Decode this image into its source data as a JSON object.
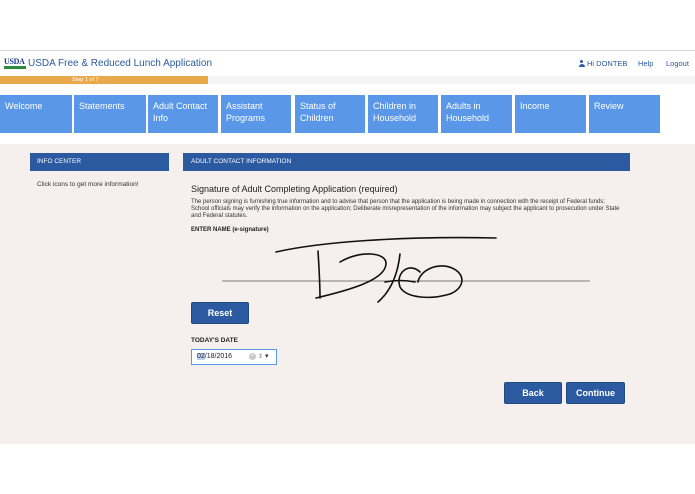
{
  "header": {
    "logo_text": "USDA",
    "app_title": "USDA Free & Reduced Lunch Application",
    "user_label": "Hi DONTEB",
    "help_label": "Help",
    "logout_label": "Logout"
  },
  "progress": {
    "label": "Step 1 of 7",
    "current_step": 1,
    "total_steps": 7
  },
  "nav": {
    "tabs": [
      {
        "label": "Welcome"
      },
      {
        "label": "Statements"
      },
      {
        "label": "Adult Contact Info"
      },
      {
        "label": "Assistant Programs"
      },
      {
        "label": "Status of Children"
      },
      {
        "label": "Children in Household"
      },
      {
        "label": "Adults in Household"
      },
      {
        "label": "Income"
      },
      {
        "label": "Review"
      }
    ]
  },
  "info_center": {
    "title": "INFO CENTER",
    "text": "Click  icons to get more information!"
  },
  "main": {
    "section_title": "ADULT CONTACT INFORMATION",
    "signature_title": "Signature of Adult Completing Application (required)",
    "signature_desc": "The person signing is furnishing true information and to advise that person that the application is being made in connection with the receipt of Federal funds; School officials may verify the information on the application; Deliberate misrepresentation of the information may subject the applicant to prosecution under State and Federal statutes.",
    "name_label": "ENTER NAME (e-signature)",
    "reset_label": "Reset",
    "date_label": "TODAY'S DATE",
    "date_month": "02",
    "date_rest": "/18/2016",
    "back_label": "Back",
    "continue_label": "Continue"
  },
  "colors": {
    "nav_tab": "#5b97e8",
    "header_blue": "#2c5aa0",
    "progress_orange": "#e9a84a",
    "content_bg": "#f5efee"
  }
}
